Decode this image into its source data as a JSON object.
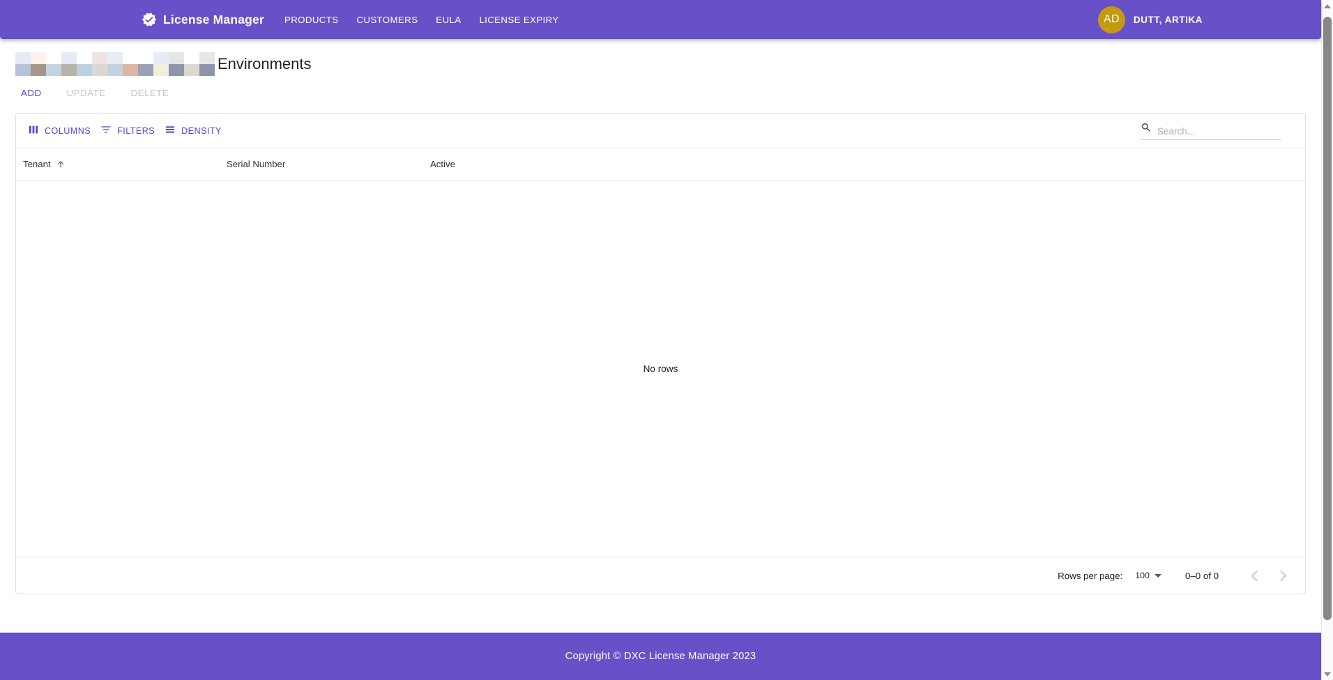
{
  "appbar": {
    "brand_icon": "verified-badge-icon",
    "brand": "License Manager",
    "nav": [
      {
        "label": "PRODUCTS"
      },
      {
        "label": "CUSTOMERS"
      },
      {
        "label": "EULA"
      },
      {
        "label": "LICENSE EXPIRY"
      }
    ],
    "user": {
      "initials": "AD",
      "name": "DUTT, ARTIKA",
      "avatar_color": "#c49a13"
    },
    "background_color": "#6750c8"
  },
  "breadcrumb": {
    "redacted": true,
    "blocks": [
      "#e6eaf4",
      "#fdf2ec",
      "#ffffff",
      "#e5eaf4",
      "#ffffff",
      "#efe2e2",
      "#e8ecf3",
      "#ffffff",
      "#ffffff",
      "#e6ebf5",
      "#e4e5e5",
      "#ffffff",
      "#e6e6e6",
      "#b6c2d6",
      "#a6978c",
      "#c3d3e2",
      "#b7b4a6",
      "#bed0e0",
      "#dbd8d1",
      "#c2d2de",
      "#dcb5a5",
      "#9aa3b6",
      "#f4eedc",
      "#8d96ab",
      "#dcd8d0",
      "#8d95a8"
    ]
  },
  "page": {
    "title": "Environments"
  },
  "actions": [
    {
      "label": "ADD",
      "enabled": true
    },
    {
      "label": "UPDATE",
      "enabled": false
    },
    {
      "label": "DELETE",
      "enabled": false
    }
  ],
  "grid_toolbar": {
    "columns_label": "COLUMNS",
    "columns_icon": "columns-icon",
    "filters_label": "FILTERS",
    "filters_icon": "filter-icon",
    "density_label": "DENSITY",
    "density_icon": "density-icon",
    "search_icon": "search-icon",
    "search_placeholder": "Search...",
    "search_value": ""
  },
  "table": {
    "columns": [
      {
        "label": "Tenant",
        "sorted": "asc",
        "sort_icon": "arrow-up-icon"
      },
      {
        "label": "Serial Number",
        "sorted": ""
      },
      {
        "label": "Active",
        "sorted": ""
      }
    ],
    "rows": [],
    "empty_message": "No rows"
  },
  "pagination": {
    "rows_per_page_label": "Rows per page:",
    "rows_per_page_value": "100",
    "range_label": "0–0 of 0",
    "prev_icon": "chevron-left-icon",
    "next_icon": "chevron-right-icon",
    "prev_enabled": false,
    "next_enabled": false
  },
  "footer": {
    "text": "Copyright © DXC License Manager 2023"
  },
  "theme": {
    "primary": "#6750c8",
    "link": "#5c3fd4",
    "disabled": "#c2c2c2"
  }
}
